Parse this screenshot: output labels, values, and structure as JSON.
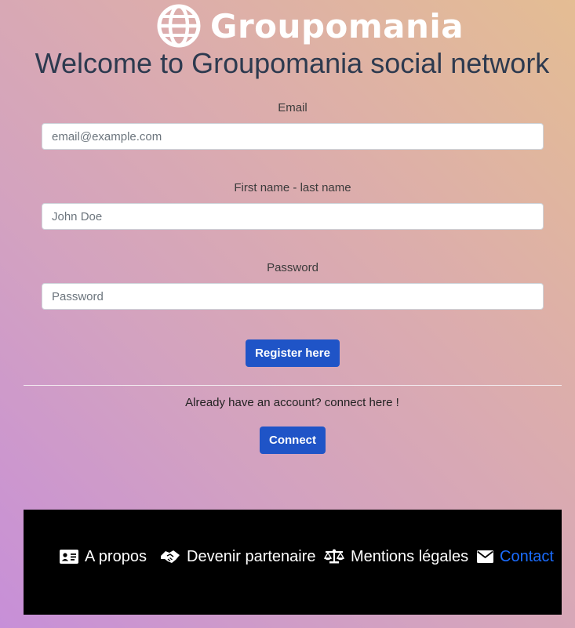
{
  "brand": {
    "name": "Groupomania"
  },
  "heading": {
    "title": "Welcome to Groupomania social network"
  },
  "form": {
    "email_label": "Email",
    "email_placeholder": "email@example.com",
    "name_label": "First name - last name",
    "name_placeholder": "John Doe",
    "password_label": "Password",
    "password_placeholder": "Password",
    "register_label": "Register here"
  },
  "login": {
    "prompt": "Already have an account? connect here !",
    "connect_label": "Connect"
  },
  "footer": {
    "links": [
      {
        "label": "A propos",
        "icon": "id-card-icon"
      },
      {
        "label": "Devenir partenaire",
        "icon": "handshake-icon"
      },
      {
        "label": "Mentions légales",
        "icon": "scale-icon"
      },
      {
        "label": "Contact",
        "icon": "envelope-icon"
      }
    ],
    "colors": {
      "link": "#ffffff",
      "active_link": "#1a6cff"
    }
  },
  "colors": {
    "button": "#1f54c7",
    "heading": "#2d3a4f",
    "footer_bg": "#000000"
  }
}
